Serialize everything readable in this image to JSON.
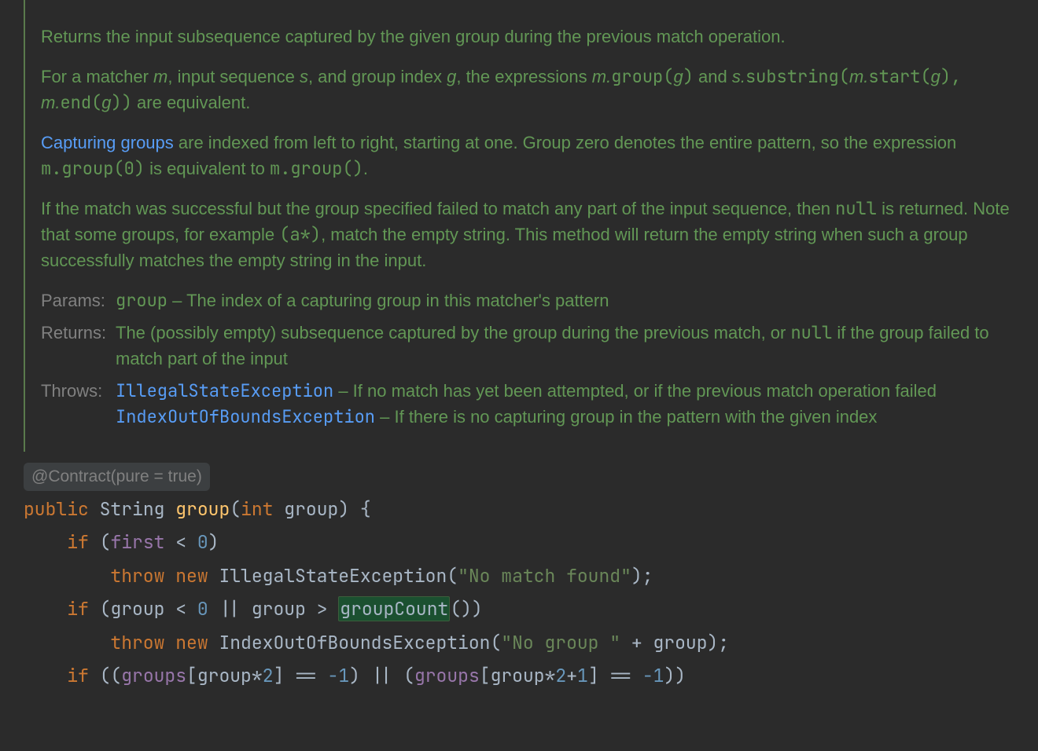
{
  "doc": {
    "p1": "Returns the input subsequence captured by the given group during the previous match operation.",
    "p2_prefix": "For a matcher ",
    "p2_m": "m",
    "p2_seq": ", input sequence ",
    "p2_s": "s",
    "p2_gi": ", and group index ",
    "p2_g": "g",
    "p2_expr": ", the expressions ",
    "p2_m2": "m.",
    "p2_group": "group(",
    "p2_g2": "g",
    "p2_close": ")",
    "p2_and": " and ",
    "p2_s2": "s.",
    "p2_sub": "substring(",
    "p2_m3": "m.",
    "p2_start": "start(",
    "p2_g3": "g",
    "p2_close2": "), ",
    "p2_m4": "m.",
    "p2_end": "end(",
    "p2_g4": "g",
    "p2_close3": "))",
    "p2_eq": " are equivalent.",
    "p3_link": "Capturing groups",
    "p3_body": " are indexed from left to right, starting at one. Group zero denotes the entire pattern, so the expression ",
    "p3_code1": "m.group(0)",
    "p3_eq": " is equivalent to ",
    "p3_code2": "m.group()",
    "p3_dot": ".",
    "p4_a": "If the match was successful but the group specified failed to match any part of the input sequence, then ",
    "p4_null": "null",
    "p4_b": " is returned. Note that some groups, for example ",
    "p4_astar": "(a*)",
    "p4_c": ", match the empty string. This method will return the empty string when such a group successfully matches the empty string in the input.",
    "params_label": "Params:",
    "params_text_pre": "group",
    "params_text_dash": " – ",
    "params_text": "The index of a capturing group in this matcher's pattern",
    "returns_label": "Returns:",
    "returns_text_a": "The (possibly empty) subsequence captured by the group during the previous match, or ",
    "returns_null": "null",
    "returns_text_b": " if the group failed to match part of the input",
    "throws_label": "Throws:",
    "throws_link1": "IllegalStateException",
    "throws_text1": " – If no match has yet been attempted, or if the previous match operation failed",
    "throws_link2": "IndexOutOfBoundsException",
    "throws_text2": " – If there is no capturing group in the pattern with the given index"
  },
  "annotation": "@Contract(pure = true)",
  "code": {
    "kw_public": "public",
    "type_string": "String",
    "method_group": "group",
    "paren_open": "(",
    "kw_int": "int",
    "param_group": "group",
    "paren_close_brace": ") {",
    "kw_if": "if",
    "lp": "(",
    "field_first": "first",
    "lt0": " < ",
    "zero": "0",
    "rp": ")",
    "kw_throw": "throw",
    "kw_new": "new",
    "cls_ise": "IllegalStateException",
    "str_nomatch": "\"No match found\"",
    "semi": ");",
    "group_ident": "group",
    "lt": " < ",
    "or": " || ",
    "gt": " > ",
    "method_groupCount": "groupCount",
    "call_close": "())",
    "cls_ioobe": "IndexOutOfBoundsException",
    "str_nogroup": "\"No group \"",
    "plus": " + ",
    "semi2": ");",
    "lpp": "((",
    "field_groups": "groups",
    "lbr": "[",
    "mul2": "*",
    "two": "2",
    "rbr": "]",
    "eqeq": " == ",
    "neg1": "-1",
    "rpp": ")",
    "plus1": "+",
    "one": "1",
    "rpp2": "))"
  }
}
